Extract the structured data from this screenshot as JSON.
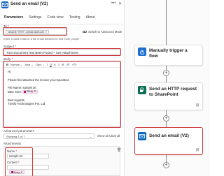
{
  "panel": {
    "title": "Send an email (V2)",
    "menu_icon": "more-icon",
    "close_icon": "close-icon",
    "tabs": [
      {
        "label": "Parameters"
      },
      {
        "label": "Settings"
      },
      {
        "label": "Code view"
      },
      {
        "label": "Testing"
      },
      {
        "label": "About"
      }
    ],
    "to": {
      "label": "To",
      "token_prefix": "rohan@",
      "token_suffix": ".onmicrosoft.com"
    },
    "switch_label": "Switch to Advanced Mode",
    "to_hint": "Enter a valid email or a full email address to find more people",
    "subject": {
      "label": "Subject",
      "value": "Your Document Has Been Found – See Attachment"
    },
    "body": {
      "label": "Body",
      "toolbar": {
        "font_style": "Normal",
        "font_name": "Arial",
        "font_size": "15px"
      },
      "lines": {
        "greeting": "Hi,",
        "intro": "Please find attached the invoice you requested.",
        "file_name": "File Name: sample.txt",
        "date_sent_label": "Date Sent:",
        "date_sent_token": "Body",
        "regards": "Best regards,",
        "company": "TSInfo Technologies Pvt. Ltd."
      }
    },
    "advanced": {
      "label": "Advanced parameters",
      "select_value": "Showing 1 of 7",
      "show_all": "Show all",
      "clear_all": "Clear all"
    },
    "attachments": {
      "label": "Attachments",
      "name_label": "Name",
      "name_value": "sample.txt",
      "content_label": "Content",
      "content_token": "Body"
    }
  },
  "flow": {
    "cards": [
      {
        "title_line1": "Manually trigger a",
        "title_line2": "flow",
        "icon": "hand-icon",
        "color": "#1f6fd1"
      },
      {
        "title_line1": "Send an HTTP request",
        "title_line2": "to SharePoint",
        "icon": "sharepoint-icon",
        "color": "#0b6e57",
        "link": "link-icon"
      },
      {
        "title_line1": "Send an email (V2)",
        "title_line2": "",
        "icon": "outlook-icon",
        "color": "#0f6cbd",
        "link": "link-icon"
      }
    ]
  }
}
